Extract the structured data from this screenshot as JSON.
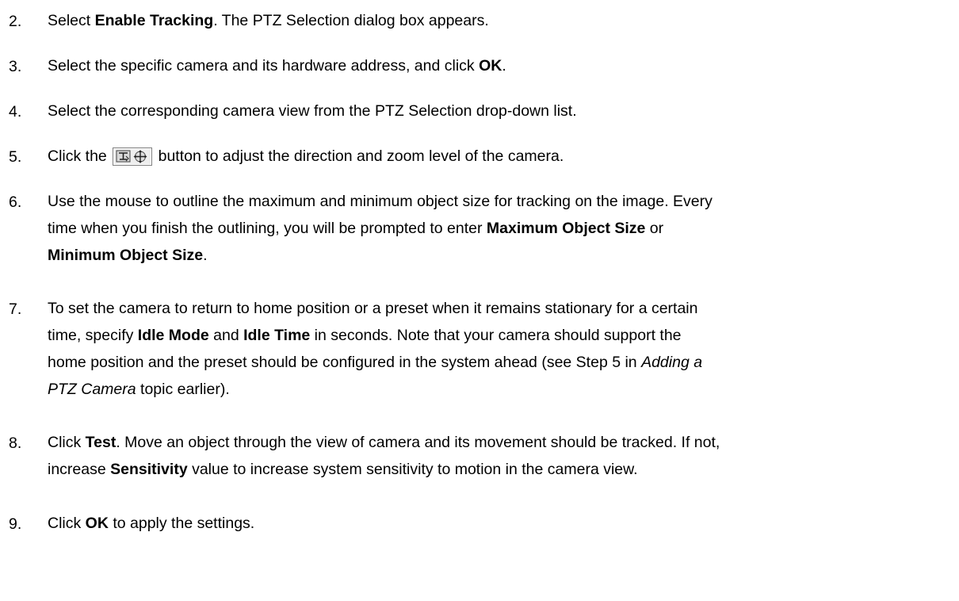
{
  "steps": [
    {
      "number": "2.",
      "lines": [
        [
          {
            "t": "Select "
          },
          {
            "t": "Enable Tracking",
            "b": true
          },
          {
            "t": ". The PTZ Selection dialog box appears."
          }
        ]
      ]
    },
    {
      "number": "3.",
      "lines": [
        [
          {
            "t": "Select the specific camera and its hardware address, and click "
          },
          {
            "t": "OK",
            "b": true
          },
          {
            "t": "."
          }
        ]
      ]
    },
    {
      "number": "4.",
      "lines": [
        [
          {
            "t": "Select the corresponding camera view from the PTZ Selection drop-down list."
          }
        ]
      ]
    },
    {
      "number": "5.",
      "lines": [
        [
          {
            "t": "Click the "
          },
          {
            "icon": "ptz-control-button-icon"
          },
          {
            "t": " button to adjust the direction and zoom level of the camera."
          }
        ]
      ]
    },
    {
      "number": "6.",
      "lines": [
        [
          {
            "t": "Use the mouse to outline the maximum and minimum object size for tracking on the image. Every"
          }
        ],
        [
          {
            "t": "time when you finish the outlining, you will be prompted to enter "
          },
          {
            "t": "Maximum Object Size",
            "b": true
          },
          {
            "t": " or"
          }
        ],
        [
          {
            "t": "Minimum Object Size",
            "b": true
          },
          {
            "t": "."
          }
        ]
      ]
    },
    {
      "number": "7.",
      "lines": [
        [
          {
            "t": "To set the camera to return to home position or a preset when it remains stationary for a certain"
          }
        ],
        [
          {
            "t": "time, specify "
          },
          {
            "t": "Idle Mode",
            "b": true
          },
          {
            "t": " and "
          },
          {
            "t": "Idle Time",
            "b": true
          },
          {
            "t": " in seconds. Note that your camera should support the"
          }
        ],
        [
          {
            "t": "home position and the preset should be configured in the system ahead (see Step 5 in "
          },
          {
            "t": "Adding a",
            "i": true
          }
        ],
        [
          {
            "t": "PTZ Camera",
            "i": true
          },
          {
            "t": " topic earlier)."
          }
        ]
      ]
    },
    {
      "number": "8.",
      "lines": [
        [
          {
            "t": "Click "
          },
          {
            "t": "Test",
            "b": true
          },
          {
            "t": ". Move an object through the view of camera and its movement should be tracked. If not,"
          }
        ],
        [
          {
            "t": "increase "
          },
          {
            "t": "Sensitivity",
            "b": true
          },
          {
            "t": " value to increase system sensitivity to motion in the camera view."
          }
        ]
      ]
    },
    {
      "number": "9.",
      "lines": [
        [
          {
            "t": "Click "
          },
          {
            "t": "OK",
            "b": true
          },
          {
            "t": " to apply the settings."
          }
        ]
      ]
    }
  ]
}
